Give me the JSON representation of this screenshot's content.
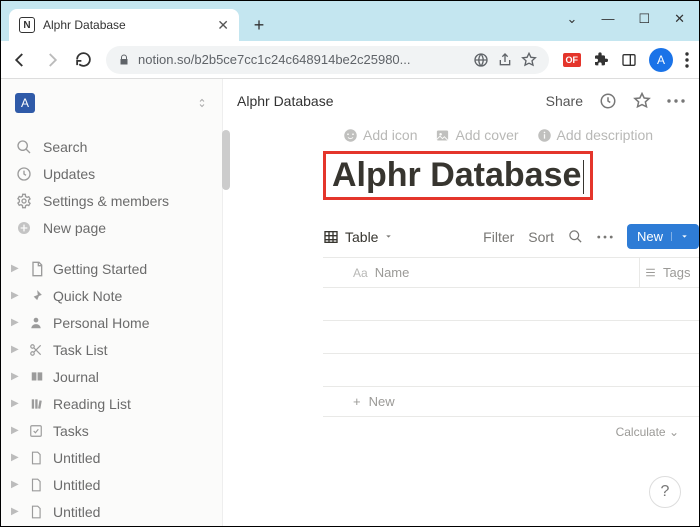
{
  "browser": {
    "tab_title": "Alphr Database",
    "url": "notion.so/b2b5ce7cc1c24c648914be2c25980...",
    "avatar_letter": "A",
    "ext_badge": "OF"
  },
  "sidebar": {
    "workspace_letter": "A",
    "quick": [
      {
        "icon": "search",
        "label": "Search"
      },
      {
        "icon": "clock",
        "label": "Updates"
      },
      {
        "icon": "gear",
        "label": "Settings & members"
      },
      {
        "icon": "plus-circle",
        "label": "New page"
      }
    ],
    "pages": [
      {
        "icon": "doc",
        "label": "Getting Started"
      },
      {
        "icon": "pin",
        "label": "Quick Note"
      },
      {
        "icon": "person",
        "label": "Personal Home"
      },
      {
        "icon": "scissors",
        "label": "Task List"
      },
      {
        "icon": "book",
        "label": "Journal"
      },
      {
        "icon": "booklist",
        "label": "Reading List"
      },
      {
        "icon": "check",
        "label": "Tasks"
      },
      {
        "icon": "page",
        "label": "Untitled"
      },
      {
        "icon": "page",
        "label": "Untitled"
      },
      {
        "icon": "page",
        "label": "Untitled"
      }
    ]
  },
  "topbar": {
    "breadcrumb": "Alphr Database",
    "share": "Share"
  },
  "page": {
    "meta": {
      "add_icon": "Add icon",
      "add_cover": "Add cover",
      "add_desc": "Add description"
    },
    "title": "Alphr Database"
  },
  "database": {
    "view_label": "Table",
    "filter": "Filter",
    "sort": "Sort",
    "new": "New",
    "col_name": "Name",
    "col_tags": "Tags",
    "new_row": "New",
    "calculate": "Calculate",
    "help": "?"
  }
}
